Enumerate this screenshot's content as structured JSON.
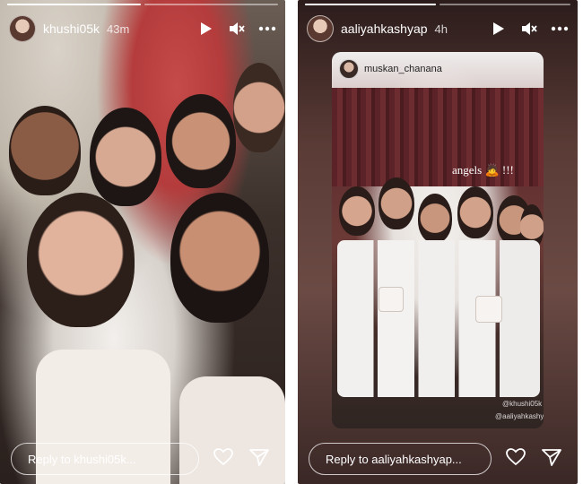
{
  "stories": [
    {
      "username": "khushi05k",
      "time": "43m",
      "reply_placeholder": "Reply to khushi05k...",
      "progress": [
        1.0,
        0.0
      ]
    },
    {
      "username": "aaliyahkashyap",
      "time": "4h",
      "reply_placeholder": "Reply to aaliyahkashyap...",
      "progress": [
        1.0,
        0.0
      ],
      "repost": {
        "username": "muskan_chanana",
        "caption": "angels 🙇 !!!",
        "tags": [
          "@khushi05k",
          "@aaliyahkashyap"
        ]
      }
    }
  ]
}
